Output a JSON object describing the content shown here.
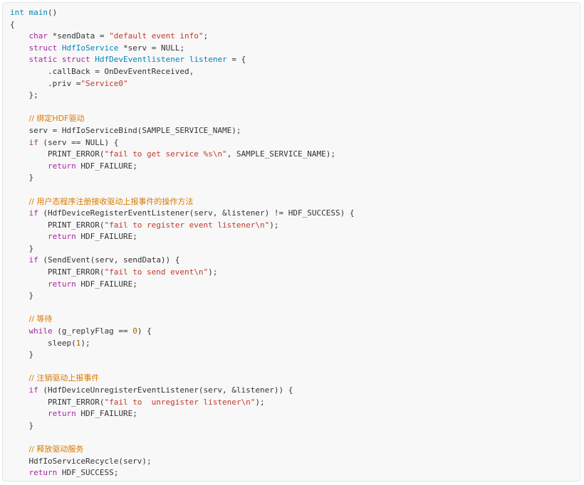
{
  "colors": {
    "keyword": "#a626a4",
    "type": "#0184bb",
    "string": "#c0392b",
    "comment": "#d97a00",
    "number": "#986801",
    "plain": "#333333",
    "background": "#f8f8f8"
  },
  "code": {
    "lines": [
      [
        {
          "t": "int",
          "c": "type"
        },
        {
          "t": " main",
          "c": "type"
        },
        {
          "t": "()",
          "c": "plain"
        }
      ],
      [
        {
          "t": "{",
          "c": "plain"
        }
      ],
      [
        {
          "t": "    ",
          "c": "plain"
        },
        {
          "t": "char",
          "c": "kw"
        },
        {
          "t": " *sendData = ",
          "c": "plain"
        },
        {
          "t": "\"default event info\"",
          "c": "str"
        },
        {
          "t": ";",
          "c": "plain"
        }
      ],
      [
        {
          "t": "    ",
          "c": "plain"
        },
        {
          "t": "struct",
          "c": "kw"
        },
        {
          "t": " ",
          "c": "plain"
        },
        {
          "t": "HdfIoService",
          "c": "type"
        },
        {
          "t": " *serv = NULL;",
          "c": "plain"
        }
      ],
      [
        {
          "t": "    ",
          "c": "plain"
        },
        {
          "t": "static",
          "c": "kw"
        },
        {
          "t": " ",
          "c": "plain"
        },
        {
          "t": "struct",
          "c": "kw"
        },
        {
          "t": " ",
          "c": "plain"
        },
        {
          "t": "HdfDevEventlistener",
          "c": "type"
        },
        {
          "t": " ",
          "c": "plain"
        },
        {
          "t": "listener",
          "c": "type"
        },
        {
          "t": " = {",
          "c": "plain"
        }
      ],
      [
        {
          "t": "        .callBack = OnDevEventReceived,",
          "c": "plain"
        }
      ],
      [
        {
          "t": "        .priv =",
          "c": "plain"
        },
        {
          "t": "\"Service0\"",
          "c": "str"
        }
      ],
      [
        {
          "t": "    };",
          "c": "plain"
        }
      ],
      [
        {
          "t": "",
          "c": "plain"
        }
      ],
      [
        {
          "t": "    ",
          "c": "plain"
        },
        {
          "t": "// 绑定HDF驱动",
          "c": "com"
        }
      ],
      [
        {
          "t": "    serv = HdfIoServiceBind(SAMPLE_SERVICE_NAME);",
          "c": "plain"
        }
      ],
      [
        {
          "t": "    ",
          "c": "plain"
        },
        {
          "t": "if",
          "c": "kw"
        },
        {
          "t": " (serv == NULL) {",
          "c": "plain"
        }
      ],
      [
        {
          "t": "        PRINT_ERROR(",
          "c": "plain"
        },
        {
          "t": "\"fail to get service %s\\n\"",
          "c": "str"
        },
        {
          "t": ", SAMPLE_SERVICE_NAME);",
          "c": "plain"
        }
      ],
      [
        {
          "t": "        ",
          "c": "plain"
        },
        {
          "t": "return",
          "c": "kw"
        },
        {
          "t": " HDF_FAILURE;",
          "c": "plain"
        }
      ],
      [
        {
          "t": "    }",
          "c": "plain"
        }
      ],
      [
        {
          "t": "",
          "c": "plain"
        }
      ],
      [
        {
          "t": "    ",
          "c": "plain"
        },
        {
          "t": "// 用户态程序注册接收驱动上报事件的操作方法",
          "c": "com"
        }
      ],
      [
        {
          "t": "    ",
          "c": "plain"
        },
        {
          "t": "if",
          "c": "kw"
        },
        {
          "t": " (HdfDeviceRegisterEventListener(serv, &listener) != HDF_SUCCESS) {",
          "c": "plain"
        }
      ],
      [
        {
          "t": "        PRINT_ERROR(",
          "c": "plain"
        },
        {
          "t": "\"fail to register event listener\\n\"",
          "c": "str"
        },
        {
          "t": ");",
          "c": "plain"
        }
      ],
      [
        {
          "t": "        ",
          "c": "plain"
        },
        {
          "t": "return",
          "c": "kw"
        },
        {
          "t": " HDF_FAILURE;",
          "c": "plain"
        }
      ],
      [
        {
          "t": "    }",
          "c": "plain"
        }
      ],
      [
        {
          "t": "    ",
          "c": "plain"
        },
        {
          "t": "if",
          "c": "kw"
        },
        {
          "t": " (SendEvent(serv, sendData)) {",
          "c": "plain"
        }
      ],
      [
        {
          "t": "        PRINT_ERROR(",
          "c": "plain"
        },
        {
          "t": "\"fail to send event\\n\"",
          "c": "str"
        },
        {
          "t": ");",
          "c": "plain"
        }
      ],
      [
        {
          "t": "        ",
          "c": "plain"
        },
        {
          "t": "return",
          "c": "kw"
        },
        {
          "t": " HDF_FAILURE;",
          "c": "plain"
        }
      ],
      [
        {
          "t": "    }",
          "c": "plain"
        }
      ],
      [
        {
          "t": "",
          "c": "plain"
        }
      ],
      [
        {
          "t": "    ",
          "c": "plain"
        },
        {
          "t": "// 等待",
          "c": "com"
        }
      ],
      [
        {
          "t": "    ",
          "c": "plain"
        },
        {
          "t": "while",
          "c": "kw"
        },
        {
          "t": " (g_replyFlag == ",
          "c": "plain"
        },
        {
          "t": "0",
          "c": "num"
        },
        {
          "t": ") {",
          "c": "plain"
        }
      ],
      [
        {
          "t": "        sleep(",
          "c": "plain"
        },
        {
          "t": "1",
          "c": "num"
        },
        {
          "t": ");",
          "c": "plain"
        }
      ],
      [
        {
          "t": "    }",
          "c": "plain"
        }
      ],
      [
        {
          "t": "",
          "c": "plain"
        }
      ],
      [
        {
          "t": "    ",
          "c": "plain"
        },
        {
          "t": "// 注销驱动上报事件",
          "c": "com"
        }
      ],
      [
        {
          "t": "    ",
          "c": "plain"
        },
        {
          "t": "if",
          "c": "kw"
        },
        {
          "t": " (HdfDeviceUnregisterEventListener(serv, &listener)) {",
          "c": "plain"
        }
      ],
      [
        {
          "t": "        PRINT_ERROR(",
          "c": "plain"
        },
        {
          "t": "\"fail to  unregister listener\\n\"",
          "c": "str"
        },
        {
          "t": ");",
          "c": "plain"
        }
      ],
      [
        {
          "t": "        ",
          "c": "plain"
        },
        {
          "t": "return",
          "c": "kw"
        },
        {
          "t": " HDF_FAILURE;",
          "c": "plain"
        }
      ],
      [
        {
          "t": "    }",
          "c": "plain"
        }
      ],
      [
        {
          "t": "",
          "c": "plain"
        }
      ],
      [
        {
          "t": "    ",
          "c": "plain"
        },
        {
          "t": "// 释放驱动服务",
          "c": "com"
        }
      ],
      [
        {
          "t": "    HdfIoServiceRecycle(serv);",
          "c": "plain"
        }
      ],
      [
        {
          "t": "    ",
          "c": "plain"
        },
        {
          "t": "return",
          "c": "kw"
        },
        {
          "t": " HDF_SUCCESS;",
          "c": "plain"
        }
      ],
      [
        {
          "t": "}",
          "c": "plain"
        }
      ]
    ]
  }
}
